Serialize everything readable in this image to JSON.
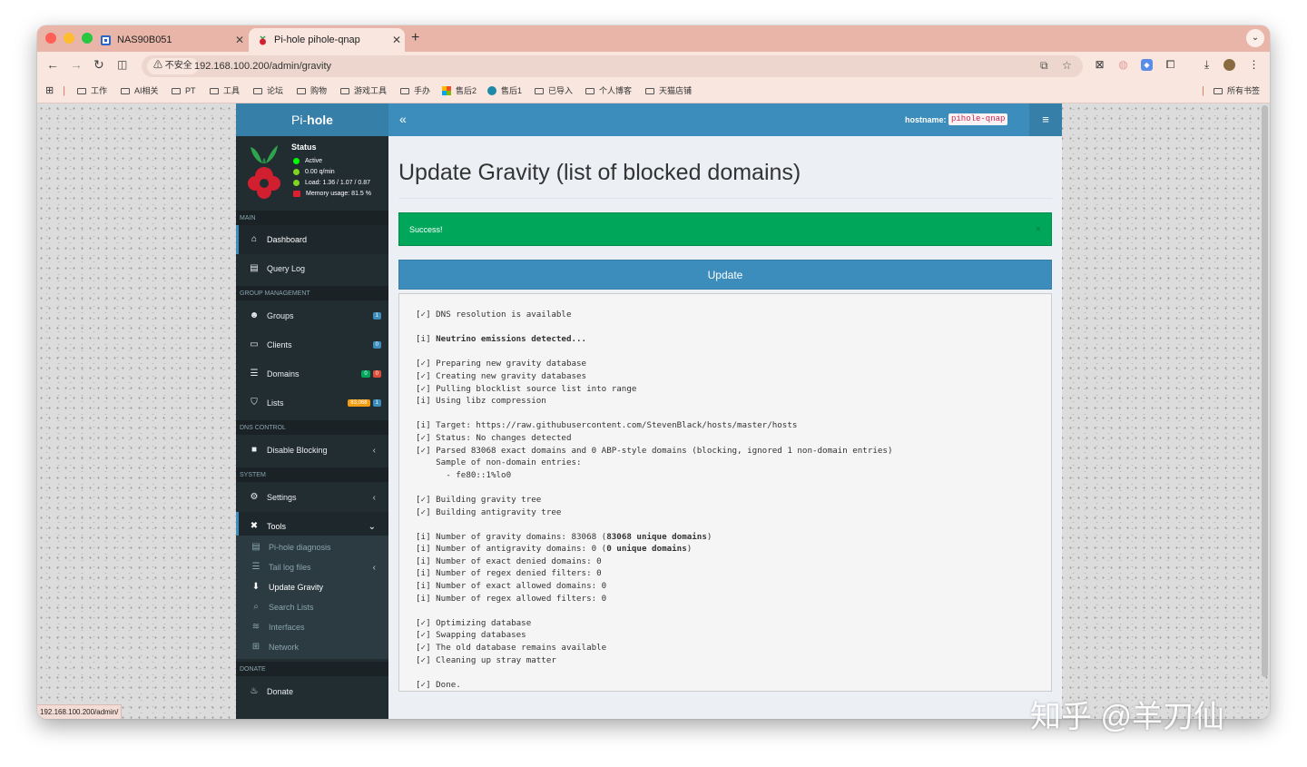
{
  "browser": {
    "tabs": [
      {
        "title": "NAS90B051"
      },
      {
        "title": "Pi-hole pihole-qnap"
      }
    ],
    "insecure_label": "不安全",
    "url": "192.168.100.200/admin/gravity",
    "bookmarks": [
      "工作",
      "AI相关",
      "PT",
      "工具",
      "论坛",
      "购物",
      "游戏工具",
      "手办",
      "售后2",
      "售后1",
      "已导入",
      "个人博客",
      "天猫店铺"
    ],
    "all_bookmarks": "所有书签",
    "status_url": "192.168.100.200/admin/"
  },
  "sidebar": {
    "logo_prefix": "Pi-",
    "logo_suffix": "hole",
    "status_title": "Status",
    "status": {
      "active": "Active",
      "rate": "0.00 q/min",
      "load": "Load: 1.36 / 1.07 / 0.87",
      "memory": "Memory usage: 81.5 %"
    },
    "sections": {
      "main": "MAIN",
      "group": "GROUP MANAGEMENT",
      "dns": "DNS CONTROL",
      "system": "SYSTEM",
      "donate": "DONATE"
    },
    "items": {
      "dashboard": "Dashboard",
      "querylog": "Query Log",
      "groups": "Groups",
      "clients": "Clients",
      "domains": "Domains",
      "lists": "Lists",
      "disable": "Disable Blocking",
      "settings": "Settings",
      "tools": "Tools",
      "donate": "Donate"
    },
    "badges": {
      "groups": "1",
      "clients": "0",
      "domains_allowed": "0",
      "domains_denied": "0",
      "lists_domains": "83,068",
      "lists_count": "1"
    },
    "tools_sub": {
      "diagnosis": "Pi-hole diagnosis",
      "taillog": "Tail log files",
      "gravity": "Update Gravity",
      "search": "Search Lists",
      "interfaces": "Interfaces",
      "network": "Network"
    }
  },
  "header": {
    "toggle": "«",
    "hostname_label": "hostname:",
    "hostname_value": "pihole-qnap",
    "menu": "≡"
  },
  "main": {
    "title": "Update Gravity (list of blocked domains)",
    "alert": "Success!",
    "alert_close": "×",
    "update_button": "Update",
    "output": [
      {
        "m": "[✓]",
        "t": "DNS resolution is available"
      },
      {
        "t": ""
      },
      {
        "m": "[i]",
        "b": "Neutrino emissions detected..."
      },
      {
        "t": ""
      },
      {
        "m": "[✓]",
        "t": "Preparing new gravity database"
      },
      {
        "m": "[✓]",
        "t": "Creating new gravity databases"
      },
      {
        "m": "[✓]",
        "t": "Pulling blocklist source list into range"
      },
      {
        "m": "[i]",
        "t": "Using libz compression"
      },
      {
        "t": ""
      },
      {
        "m": "[i]",
        "t": "Target: https://raw.githubusercontent.com/StevenBlack/hosts/master/hosts"
      },
      {
        "m": "[✓]",
        "t": "Status: No changes detected"
      },
      {
        "m": "[✓]",
        "t": "Parsed 83068 exact domains and 0 ABP-style domains (blocking, ignored 1 non-domain entries)"
      },
      {
        "t": "    Sample of non-domain entries:"
      },
      {
        "t": "      - fe80::1%lo0"
      },
      {
        "t": ""
      },
      {
        "m": "[✓]",
        "t": "Building gravity tree"
      },
      {
        "m": "[✓]",
        "t": "Building antigravity tree"
      },
      {
        "t": ""
      },
      {
        "m": "[i]",
        "t": "Number of gravity domains: 83068 (",
        "b": "83068 unique domains",
        "a": ")"
      },
      {
        "m": "[i]",
        "t": "Number of antigravity domains: 0 (",
        "b": "0 unique domains",
        "a": ")"
      },
      {
        "m": "[i]",
        "t": "Number of exact denied domains: 0"
      },
      {
        "m": "[i]",
        "t": "Number of regex denied filters: 0"
      },
      {
        "m": "[i]",
        "t": "Number of exact allowed domains: 0"
      },
      {
        "m": "[i]",
        "t": "Number of regex allowed filters: 0"
      },
      {
        "t": ""
      },
      {
        "m": "[✓]",
        "t": "Optimizing database"
      },
      {
        "m": "[✓]",
        "t": "Swapping databases"
      },
      {
        "m": "[✓]",
        "t": "The old database remains available"
      },
      {
        "m": "[✓]",
        "t": "Cleaning up stray matter"
      },
      {
        "t": ""
      },
      {
        "m": "[✓]",
        "t": "Done."
      }
    ]
  },
  "watermark": "知乎 @羊刀仙",
  "colors": {
    "tabbar": "#e8b5a8",
    "toolbar": "#f8e6df",
    "sidebar": "#222d32",
    "header": "#3c8dbc",
    "success": "#00a65a",
    "raspberry_red": "#d11f2f",
    "raspberry_leaf": "#2ea44f"
  }
}
